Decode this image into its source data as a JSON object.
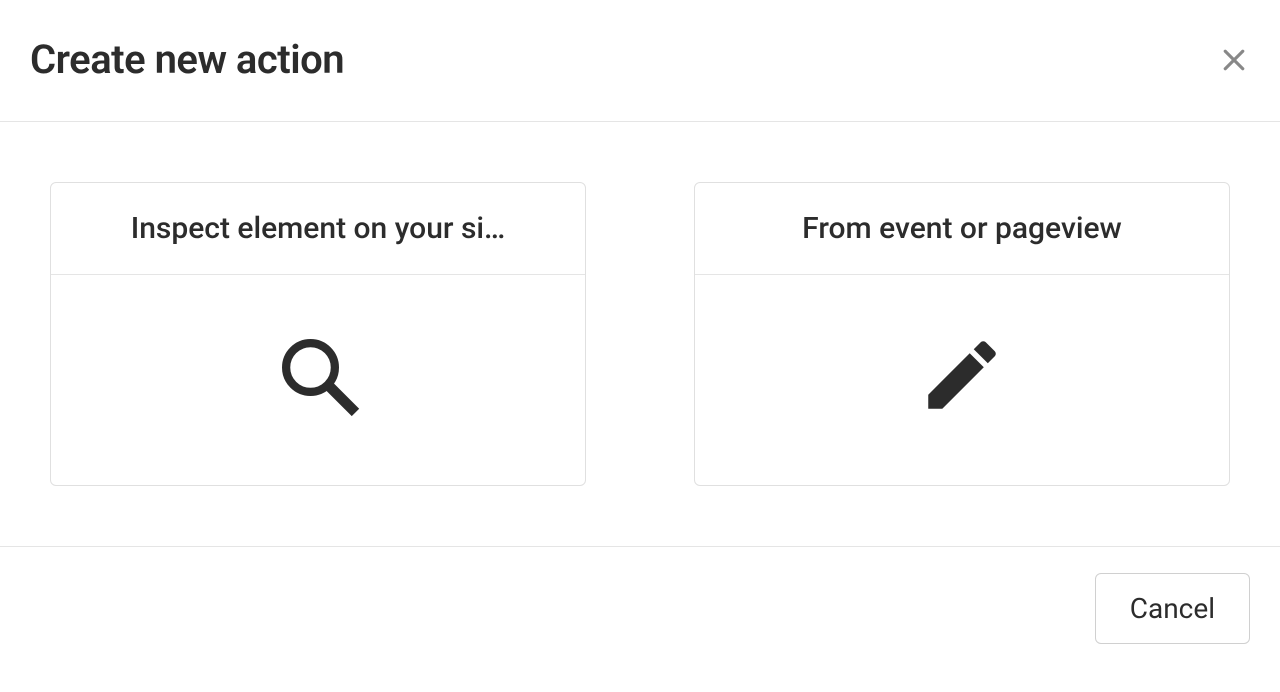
{
  "modal": {
    "title": "Create new action",
    "options": [
      {
        "title": "Inspect element on your si…"
      },
      {
        "title": "From event or pageview"
      }
    ],
    "footer": {
      "cancel_label": "Cancel"
    }
  }
}
